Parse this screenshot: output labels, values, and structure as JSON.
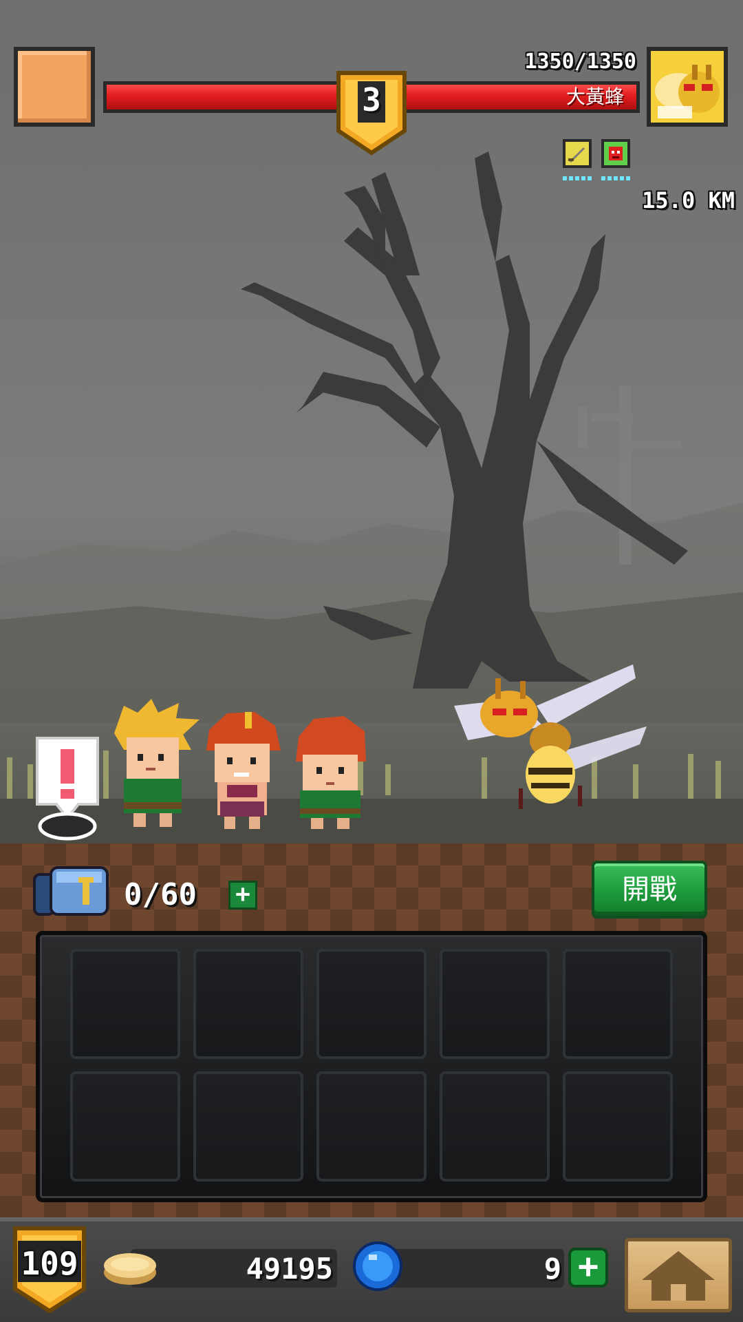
{
  "hud": {
    "boss_hp": "1350/1350",
    "boss_hp_fraction": 1.0,
    "boss_name": "大黃蜂",
    "stage_number": "3",
    "distance": "15.0 KM",
    "buffs": [
      "sword-buff-icon",
      "devil-buff-icon"
    ]
  },
  "inventory": {
    "count": "0/60",
    "slots_rows": 2,
    "slots_cols": 5
  },
  "battle_button": {
    "label": "開戰"
  },
  "bottom_bar": {
    "level": "109",
    "gold": "49195",
    "gems": "9"
  },
  "colors": {
    "hp_red": "#e01d1d",
    "battle_green": "#1d9a3c",
    "player_portrait": "#f3a45e",
    "badge_gold": "#f2a823"
  }
}
